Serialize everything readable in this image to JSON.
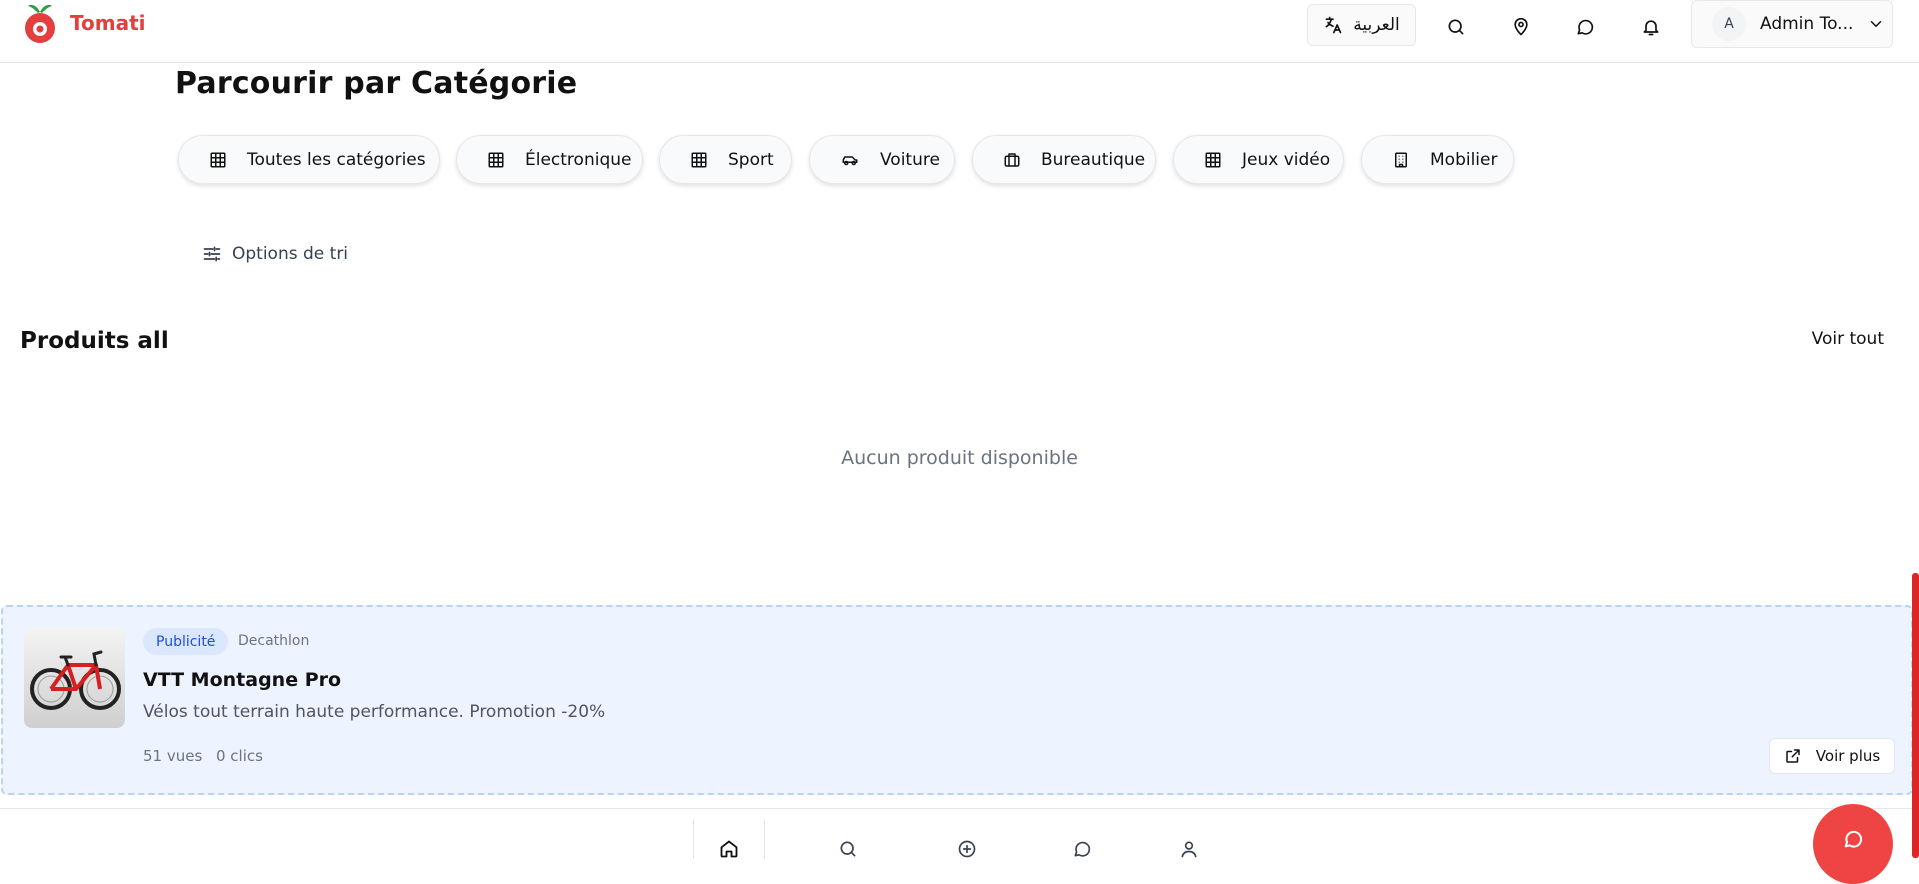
{
  "brand": {
    "name": "Tomati",
    "color": "#e53e3e"
  },
  "header": {
    "language_label": "العربية",
    "icons": [
      "translate-icon",
      "search-icon",
      "map-pin-icon",
      "message-icon",
      "bell-icon",
      "chevron-down-icon"
    ],
    "user": {
      "avatar_initial": "A",
      "name": "Admin To..."
    }
  },
  "categories": {
    "title": "Parcourir par Catégorie",
    "items": [
      {
        "label": "Toutes les catégories",
        "icon": "grid-icon"
      },
      {
        "label": "Électronique",
        "icon": "grid-icon"
      },
      {
        "label": "Sport",
        "icon": "grid-icon"
      },
      {
        "label": "Voiture",
        "icon": "car-icon"
      },
      {
        "label": "Bureautique",
        "icon": "briefcase-icon"
      },
      {
        "label": "Jeux vidéo",
        "icon": "grid-icon"
      },
      {
        "label": "Mobilier",
        "icon": "building-icon"
      }
    ]
  },
  "sort": {
    "label": "Options de tri"
  },
  "products": {
    "title": "Produits all",
    "see_all": "Voir tout",
    "empty_message": "Aucun produit disponible"
  },
  "ad": {
    "badge": "Publicité",
    "advertiser": "Decathlon",
    "title": "VTT Montagne Pro",
    "description": "Vélos tout terrain haute performance. Promotion -20%",
    "views": "51 vues",
    "clicks": "0 clics",
    "cta": "Voir plus",
    "accent_color": "#1d4ed8"
  },
  "bottom_nav": {
    "items": [
      "home-icon",
      "search-icon",
      "plus-circle-icon",
      "message-icon",
      "user-icon"
    ]
  },
  "colors": {
    "accent": "#ef4444",
    "ad_background": "#eef4ff"
  }
}
